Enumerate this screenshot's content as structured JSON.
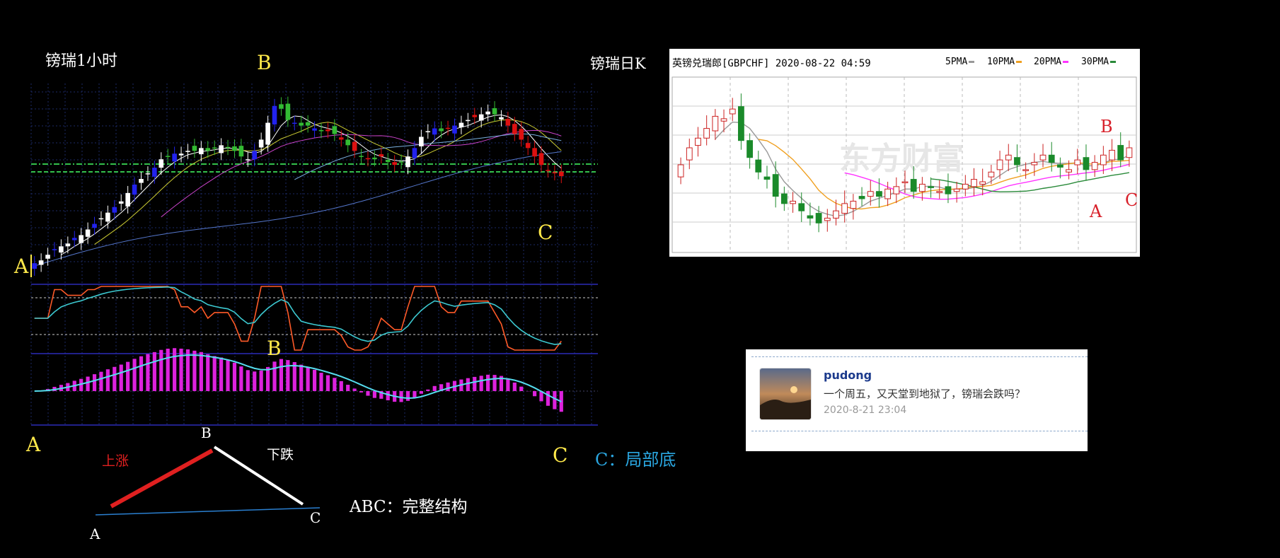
{
  "labels": {
    "hourly_title": "镑瑞1小时",
    "daily_title": "镑瑞日K",
    "b_top": "B",
    "a_left": "A",
    "c_mid": "C",
    "b_macd": "B",
    "a_bottom": "A",
    "c_bottom": "C",
    "c_local_bottom": "C：局部底",
    "diagram_b": "B",
    "diagram_a": "A",
    "diagram_c": "C",
    "rise": "上涨",
    "fall": "下跌",
    "abc_structure": "ABC：完整结构"
  },
  "daily": {
    "header": "英镑兑瑞郎[GBPCHF] 2020-08-22 04:59",
    "legend": [
      {
        "name": "5PMA",
        "color": "#999999"
      },
      {
        "name": "10PMA",
        "color": "#f0a020"
      },
      {
        "name": "20PMA",
        "color": "#ff33ff"
      },
      {
        "name": "30PMA",
        "color": "#2a8a3a"
      }
    ],
    "watermark": "东方财富",
    "mark_b": "B",
    "mark_a": "A",
    "mark_c": "C"
  },
  "comment": {
    "username": "pudong",
    "text": "一个周五，又天堂到地狱了，镑瑞会跌吗？",
    "time": "2020-8-21 23:04"
  },
  "colors": {
    "yellow": "#ffe94a",
    "red_mark": "#d8202a",
    "cyan_text": "#2aa6e0",
    "candle_up": "#cc2222",
    "candle_down": "#1a8a2a",
    "hourly_bull": "#ffffff",
    "hourly_bull_trend": "#2222ee",
    "hourly_bear_trend": "#dd1111",
    "macd_hist": "#dd22dd",
    "osc_fast": "#ff5a28",
    "osc_slow": "#3cc8d0"
  },
  "chart_data": [
    {
      "type": "candlestick",
      "title": "镑瑞1小时",
      "close": [
        1.181,
        1.182,
        1.184,
        1.186,
        1.187,
        1.188,
        1.19,
        1.191,
        1.193,
        1.195,
        1.197,
        1.199,
        1.201,
        1.203,
        1.206,
        1.209,
        1.211,
        1.213,
        1.215,
        1.218,
        1.219,
        1.22,
        1.22,
        1.221,
        1.221,
        1.222,
        1.221,
        1.222,
        1.223,
        1.222,
        1.221,
        1.219,
        1.218,
        1.221,
        1.225,
        1.231,
        1.237,
        1.236,
        1.232,
        1.231,
        1.23,
        1.23,
        1.229,
        1.228,
        1.228,
        1.227,
        1.225,
        1.223,
        1.221,
        1.219,
        1.218,
        1.218,
        1.219,
        1.217,
        1.216,
        1.217,
        1.219,
        1.222,
        1.226,
        1.228,
        1.229,
        1.228,
        1.229,
        1.23,
        1.231,
        1.232,
        1.233,
        1.234,
        1.235,
        1.234,
        1.233,
        1.23,
        1.227,
        1.225,
        1.222,
        1.219,
        1.216,
        1.214,
        1.213,
        1.212
      ],
      "legend": "none"
    },
    {
      "type": "candlestick",
      "title": "英镑兑瑞郎[GBPCHF] 2020-08-22 04:59",
      "close": [
        1.205,
        1.212,
        1.216,
        1.22,
        1.225,
        1.224,
        1.228,
        1.215,
        1.208,
        1.202,
        1.199,
        1.192,
        1.189,
        1.19,
        1.186,
        1.183,
        1.181,
        1.183,
        1.186,
        1.189,
        1.19,
        1.191,
        1.194,
        1.192,
        1.195,
        1.196,
        1.198,
        1.194,
        1.197,
        1.196,
        1.194,
        1.193,
        1.195,
        1.197,
        1.199,
        1.198,
        1.202,
        1.207,
        1.209,
        1.205,
        1.203,
        1.206,
        1.209,
        1.206,
        1.204,
        1.203,
        1.207,
        1.203,
        1.206,
        1.209,
        1.211,
        1.207,
        1.212
      ],
      "series": [
        {
          "name": "5PMA"
        },
        {
          "name": "10PMA"
        },
        {
          "name": "20PMA"
        },
        {
          "name": "30PMA"
        }
      ],
      "legend": "top-right"
    }
  ]
}
